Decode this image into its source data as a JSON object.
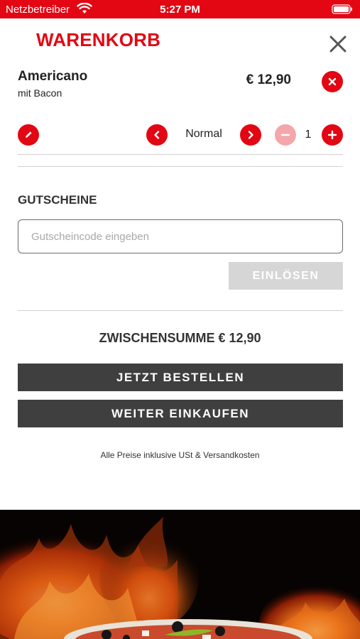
{
  "status": {
    "carrier": "Netzbetreiber",
    "time": "5:27 PM",
    "brand_color": "#e30613"
  },
  "header": {
    "title": "WARENKORB",
    "close_icon": "close-x-icon"
  },
  "cart_item": {
    "name": "Americano",
    "extras": "mit Bacon",
    "price": "€ 12,90",
    "size": "Normal",
    "quantity": "1",
    "icons": {
      "remove": "remove-circle-x-icon",
      "edit": "pencil-icon",
      "size_prev": "chevron-left-icon",
      "size_next": "chevron-right-icon",
      "qty_minus": "minus-icon",
      "qty_plus": "plus-icon"
    }
  },
  "voucher": {
    "section_title": "GUTSCHEINE",
    "placeholder": "Gutscheincode eingeben",
    "value": "",
    "redeem_label": "EINLÖSEN"
  },
  "summary": {
    "subtotal": "ZWISCHENSUMME € 12,90",
    "order_label": "JETZT BESTELLEN",
    "continue_label": "WEITER EINKAUFEN",
    "legal": "Alle Preise inklusive USt & Versandkosten"
  },
  "colors": {
    "accent": "#e30613",
    "accent_disabled": "#f4a6ab",
    "button_dark": "#3f3f3f",
    "button_disabled": "#d6d6d6"
  }
}
